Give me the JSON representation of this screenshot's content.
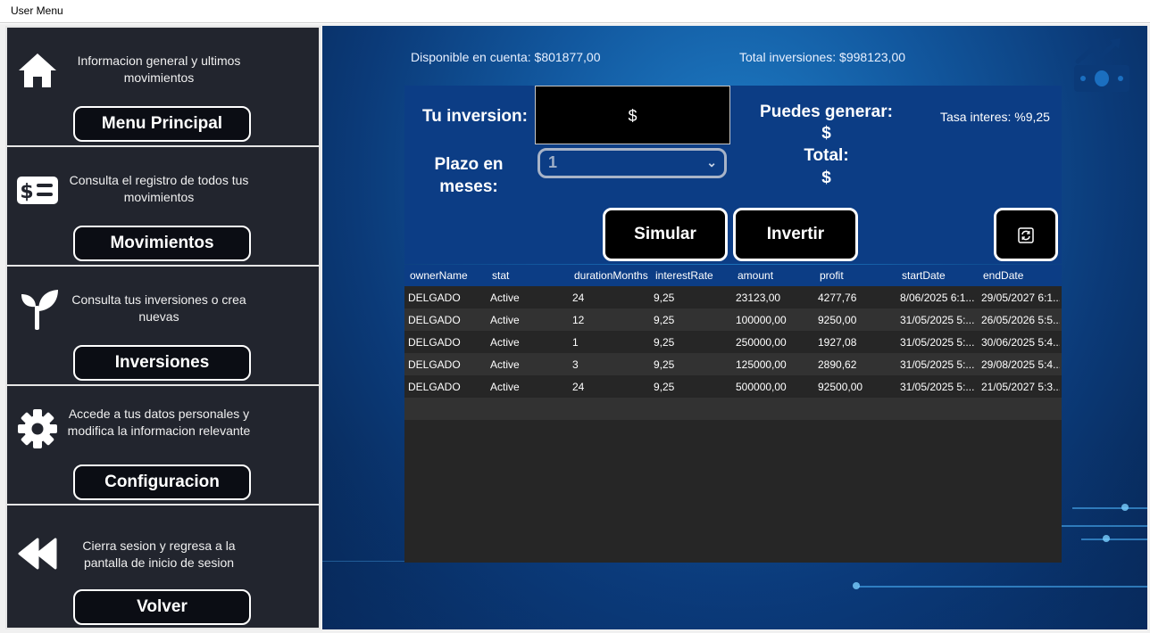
{
  "window": {
    "title": "User Menu"
  },
  "sidebar": {
    "items": [
      {
        "icon": "home-icon",
        "description": "Informacion general y ultimos movimientos",
        "button": "Menu Principal"
      },
      {
        "icon": "money-list-icon",
        "description": "Consulta el registro de todos tus movimientos",
        "button": "Movimientos"
      },
      {
        "icon": "sprout-icon",
        "description": "Consulta tus inversiones o crea nuevas",
        "button": "Inversiones"
      },
      {
        "icon": "gear-icon",
        "description": "Accede a tus datos personales y modifica la informacion relevante",
        "button": "Configuracion"
      },
      {
        "icon": "rewind-icon",
        "description": "Cierra sesion y regresa a la pantalla de inicio de sesion",
        "button": "Volver"
      }
    ]
  },
  "header": {
    "available": "Disponible en cuenta: $801877,00",
    "total_investments": "Total inversiones: $998123,00"
  },
  "form": {
    "investment_label": "Tu inversion:",
    "amount_value": "$",
    "term_label": "Plazo en meses:",
    "term_selected": "1",
    "can_generate_label": "Puedes generar:",
    "can_generate_value": "$",
    "total_label": "Total:",
    "total_value": "$",
    "interest_rate": "Tasa interes: %9,25",
    "simulate_button": "Simular",
    "invest_button": "Invertir"
  },
  "table": {
    "columns": [
      "ownerName",
      "stat",
      "durationMonths",
      "interestRate",
      "amount",
      "profit",
      "startDate",
      "endDate"
    ],
    "rows": [
      [
        "DELGADO",
        "Active",
        "24",
        "9,25",
        "23123,00",
        "4277,76",
        "8/06/2025 6:1...",
        "29/05/2027 6:1..."
      ],
      [
        "DELGADO",
        "Active",
        "12",
        "9,25",
        "100000,00",
        "9250,00",
        "31/05/2025 5:...",
        "26/05/2026 5:5..."
      ],
      [
        "DELGADO",
        "Active",
        "1",
        "9,25",
        "250000,00",
        "1927,08",
        "31/05/2025 5:...",
        "30/06/2025 5:4..."
      ],
      [
        "DELGADO",
        "Active",
        "3",
        "9,25",
        "125000,00",
        "2890,62",
        "31/05/2025 5:...",
        "29/08/2025 5:4..."
      ],
      [
        "DELGADO",
        "Active",
        "24",
        "9,25",
        "500000,00",
        "92500,00",
        "31/05/2025 5:...",
        "21/05/2027 5:3..."
      ]
    ]
  }
}
